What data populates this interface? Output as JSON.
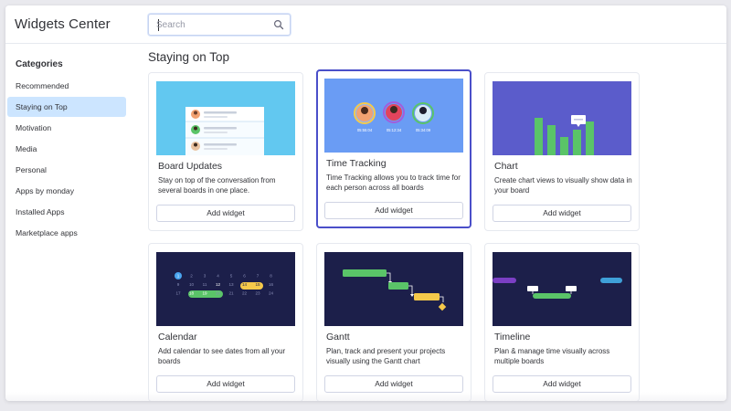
{
  "header": {
    "title": "Widgets Center",
    "search_placeholder": "Search"
  },
  "sidebar": {
    "heading": "Categories",
    "items": [
      {
        "label": "Recommended",
        "active": false
      },
      {
        "label": "Staying on Top",
        "active": true
      },
      {
        "label": "Motivation",
        "active": false
      },
      {
        "label": "Media",
        "active": false
      },
      {
        "label": "Personal",
        "active": false
      },
      {
        "label": "Apps by monday",
        "active": false
      },
      {
        "label": "Installed Apps",
        "active": false
      },
      {
        "label": "Marketplace apps",
        "active": false
      }
    ]
  },
  "main": {
    "section_title": "Staying on Top",
    "cards": [
      {
        "title": "Board Updates",
        "desc": "Stay on top of the conversation from several boards in one place.",
        "button": "Add widget",
        "selected": false
      },
      {
        "title": "Time Tracking",
        "desc": "Time Tracking allows you to track time for each person across all boards",
        "button": "Add widget",
        "selected": true,
        "timers": [
          "05:55:04",
          "05:12:34",
          "05:34:09"
        ]
      },
      {
        "title": "Chart",
        "desc": "Create chart views to visually show data in your board",
        "button": "Add widget",
        "selected": false
      },
      {
        "title": "Calendar",
        "desc": "Add calendar to see dates from all your boards",
        "button": "Add widget",
        "selected": false,
        "calendar_days": [
          [
            "1",
            "2",
            "3",
            "4",
            "5",
            "6",
            "7",
            "8"
          ],
          [
            "9",
            "10",
            "11",
            "12",
            "13",
            "14",
            "15",
            "16"
          ],
          [
            "17",
            "18",
            "19",
            "20",
            "21",
            "22",
            "23",
            "24"
          ]
        ]
      },
      {
        "title": "Gantt",
        "desc": "Plan, track and present your projects visually using the Gantt chart",
        "button": "Add widget",
        "selected": false
      },
      {
        "title": "Timeline",
        "desc": "Plan & manage time visually across multiple boards",
        "button": "Add widget",
        "selected": false
      }
    ]
  },
  "colors": {
    "accent": "#4a4fc9",
    "sidebar_active": "#cce5ff",
    "board_updates_bg": "#62c8f0",
    "time_tracking_bg": "#6a9cf4",
    "chart_bg": "#5b5ccb",
    "dark_bg": "#1c1f4a",
    "green": "#5ac468",
    "yellow": "#f5c94a"
  }
}
